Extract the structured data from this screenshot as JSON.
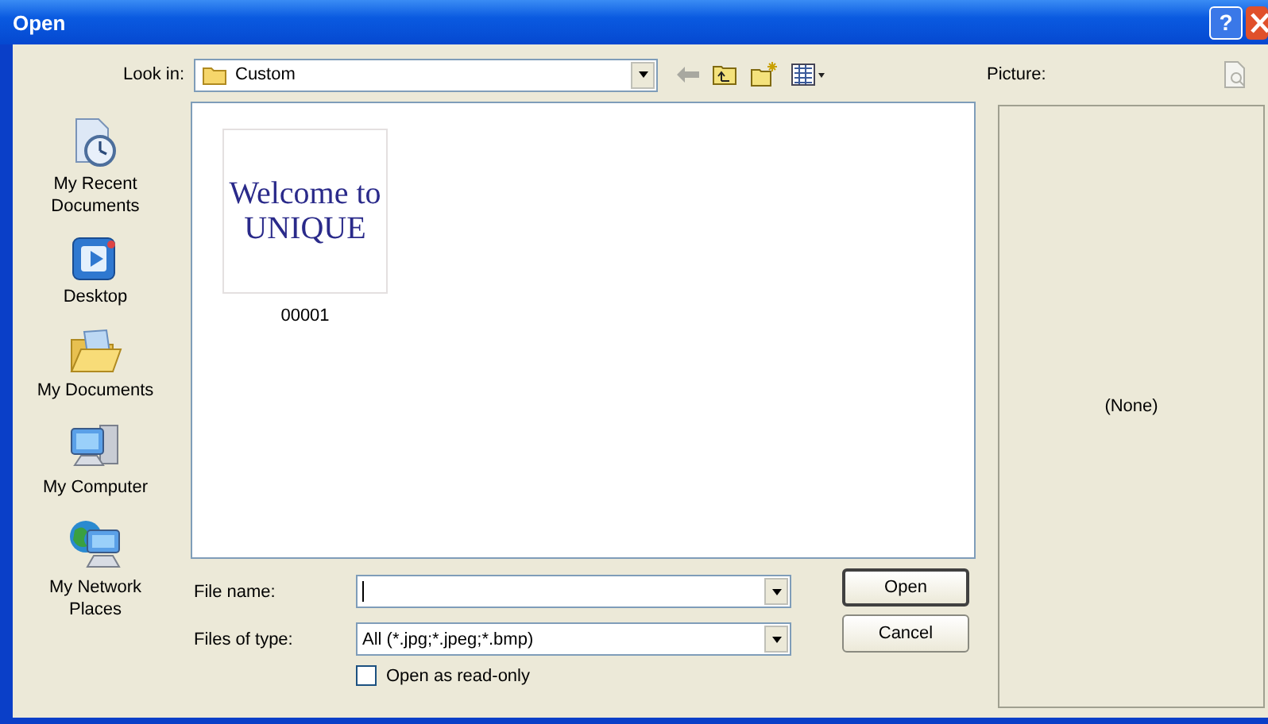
{
  "window": {
    "title": "Open",
    "help": "?"
  },
  "look_in": {
    "label": "Look in:",
    "value": "Custom"
  },
  "preview": {
    "label": "Picture:",
    "status": "(None)"
  },
  "places": [
    {
      "label": "My Recent Documents",
      "kind": "recent"
    },
    {
      "label": "Desktop",
      "kind": "desktop"
    },
    {
      "label": "My Documents",
      "kind": "documents"
    },
    {
      "label": "My Computer",
      "kind": "computer"
    },
    {
      "label": "My Network Places",
      "kind": "network"
    }
  ],
  "files": [
    {
      "name": "00001",
      "thumbnail_lines": [
        "Welcome to",
        "UNIQUE"
      ]
    }
  ],
  "file_name": {
    "label": "File name:"
  },
  "file_type": {
    "label": "Files of type:",
    "value": "All (*.jpg;*.jpeg;*.bmp)"
  },
  "read_only": {
    "label": "Open as read-only",
    "checked": false
  },
  "buttons": [
    {
      "label": "Open",
      "default": true
    },
    {
      "label": "Cancel",
      "default": false
    }
  ]
}
